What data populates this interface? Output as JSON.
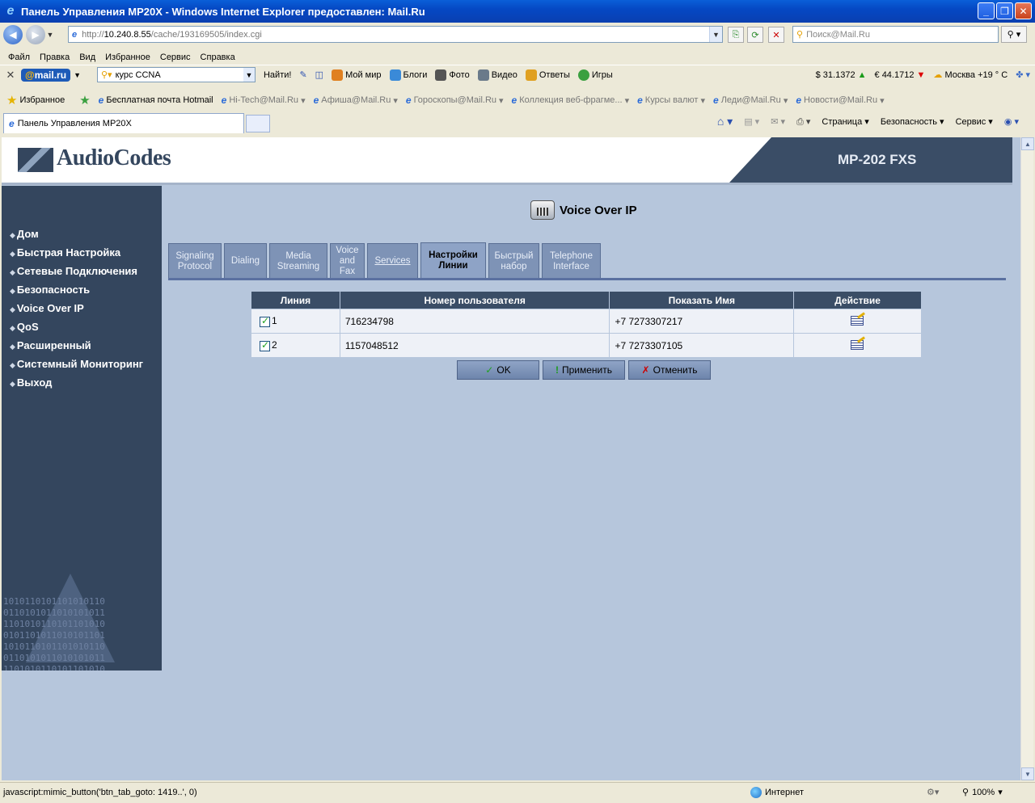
{
  "window": {
    "title": "Панель Управления MP20X - Windows Internet Explorer предоставлен: Mail.Ru",
    "minimize": "_",
    "maximize": "❐",
    "close": "✕"
  },
  "address": {
    "scheme": "http://",
    "host": "10.240.8.55",
    "path": "/cache/193169505/index.cgi",
    "search_placeholder": "Поиск@Mail.Ru"
  },
  "menu": [
    "Файл",
    "Правка",
    "Вид",
    "Избранное",
    "Сервис",
    "Справка"
  ],
  "mailbar": {
    "logo_at": "@",
    "logo_rest": "mail.ru",
    "search_value": "курс CCNA",
    "find_label": "Найти!",
    "items": [
      "Мой мир",
      "Блоги",
      "Фото",
      "Видео",
      "Ответы",
      "Игры"
    ],
    "usd": "$ 31.1372",
    "eur": "€ 44.1712",
    "weather": "Москва +19 ° C"
  },
  "favorites": {
    "label": "Избранное",
    "links": [
      "Бесплатная почта Hotmail",
      "Hi-Tech@Mail.Ru",
      "Афиша@Mail.Ru",
      "Гороскопы@Mail.Ru",
      "Коллекция веб-фрагме...",
      "Курсы валют",
      "Леди@Mail.Ru",
      "Новости@Mail.Ru"
    ]
  },
  "browser_tab": {
    "label": "Панель Управления MP20X",
    "commands": [
      "Страница",
      "Безопасность",
      "Сервис"
    ]
  },
  "header": {
    "logo_text": "AudioCodes",
    "model": "MP-202 FXS"
  },
  "nav": [
    "Дом",
    "Быстрая Настройка",
    "Сетевые Подключения",
    "Безопасность",
    "Voice Over IP",
    "QoS",
    "Расширенный",
    "Системный Мониторинг",
    "Выход"
  ],
  "nav_deco": [
    "1010110101101010110",
    "0110101011010101011",
    "1101010110101101010",
    "0101101011010101101",
    "1010110101101010110",
    "0110101011010101011",
    "1101010110101101010"
  ],
  "page_title": "Voice Over IP",
  "tabs": [
    {
      "line1": "Signaling",
      "line2": "Protocol"
    },
    {
      "line1": "Dialing",
      "line2": ""
    },
    {
      "line1": "Media",
      "line2": "Streaming"
    },
    {
      "line1": "Voice",
      "line2": "and",
      "line3": "Fax"
    },
    {
      "line1": "Services",
      "line2": ""
    },
    {
      "line1": "Настройки",
      "line2": "Линии"
    },
    {
      "line1": "Быстрый",
      "line2": "набор"
    },
    {
      "line1": "Telephone",
      "line2": "Interface"
    }
  ],
  "table": {
    "headers": [
      "Линия",
      "Номер пользователя",
      "Показать Имя",
      "Действие"
    ],
    "rows": [
      {
        "line": "1",
        "user": "716234798",
        "name": "+7 7273307217",
        "enabled": true
      },
      {
        "line": "2",
        "user": "1157048512",
        "name": "+7 7273307105",
        "enabled": true
      }
    ]
  },
  "buttons": {
    "ok": "OK",
    "apply": "Применить",
    "cancel": "Отменить"
  },
  "status": {
    "message": "javascript:mimic_button('btn_tab_goto: 1419..', 0)",
    "zone": "Интернет",
    "zoom": "100%"
  }
}
